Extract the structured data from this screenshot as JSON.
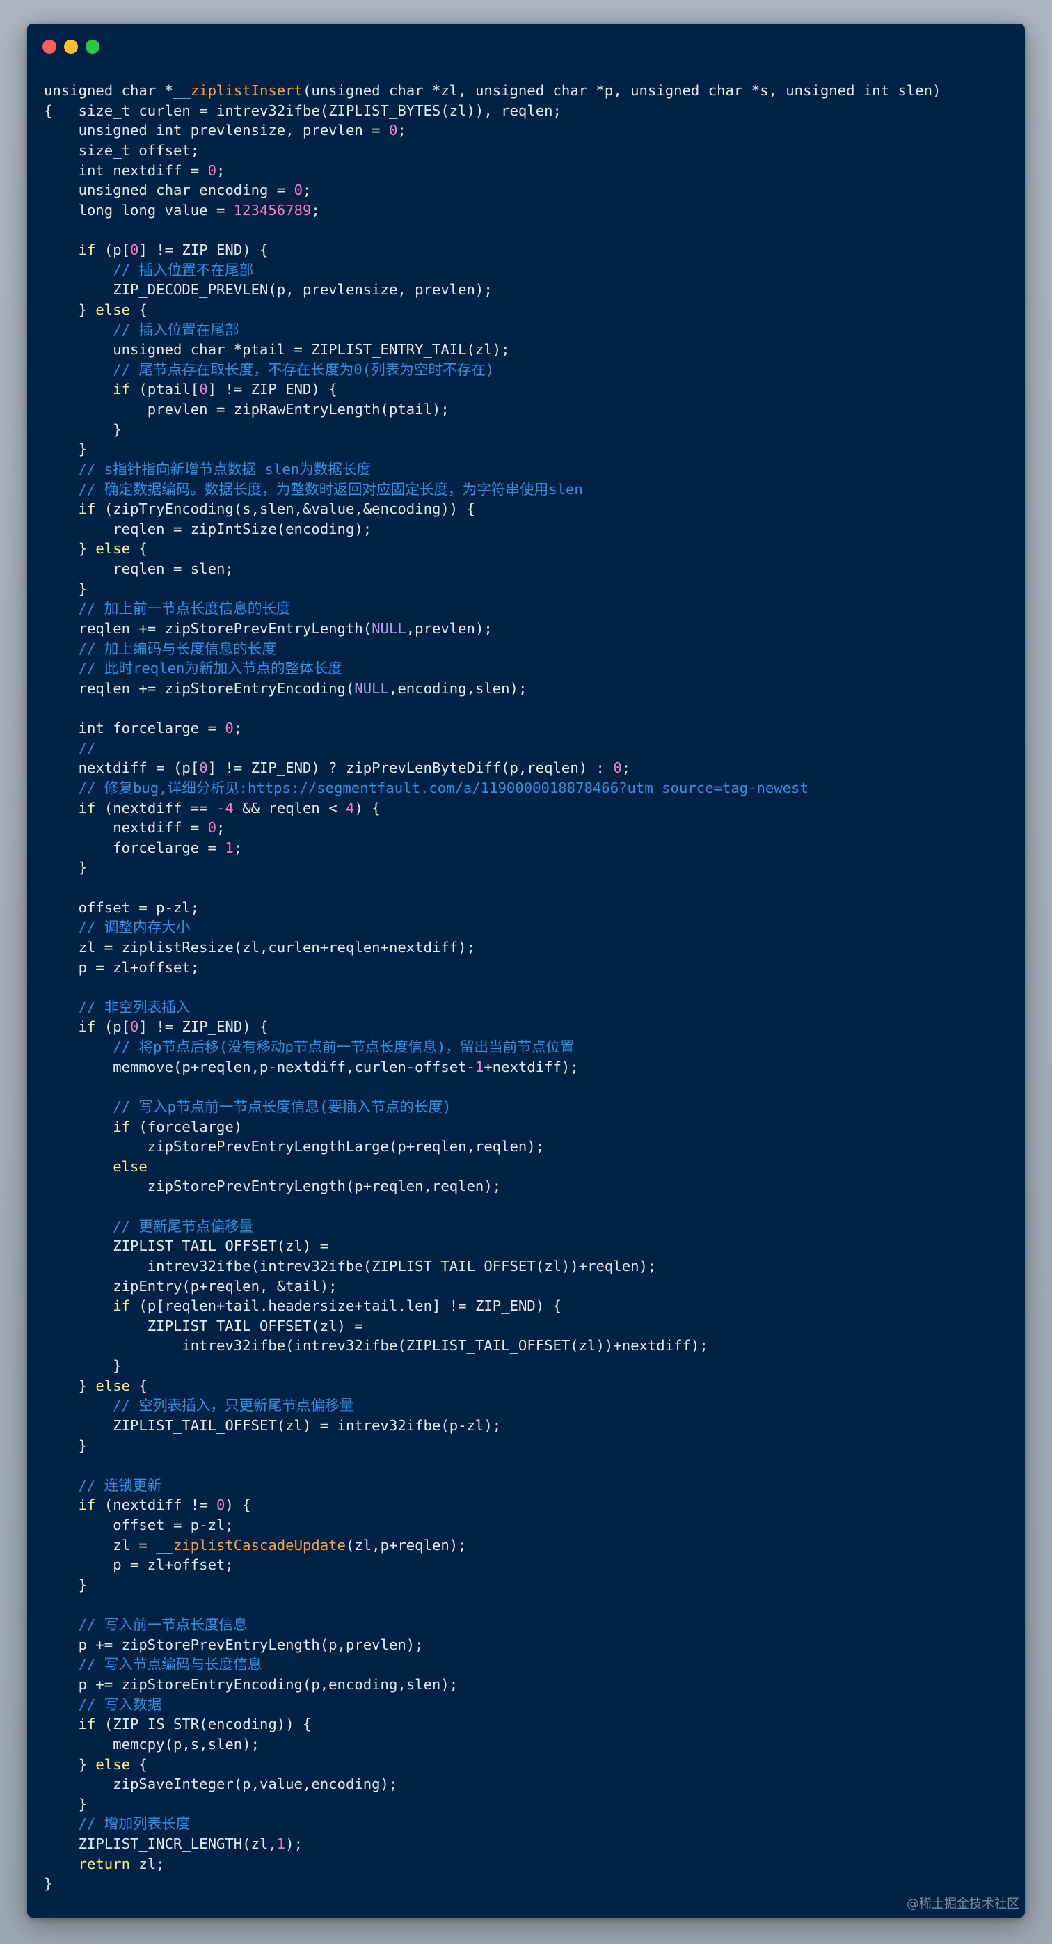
{
  "window": {
    "buttons": [
      "close",
      "minimize",
      "maximize"
    ],
    "colors": {
      "background": "#002244",
      "red": "#ff5f57",
      "yellow": "#febc2e",
      "green": "#28c840"
    }
  },
  "code_lines": [
    [
      [
        "",
        "unsigned char *"
      ],
      [
        "fn",
        "__ziplistInsert"
      ],
      [
        "",
        "(unsigned char *zl, unsigned char *p, unsigned char *s, unsigned int slen)"
      ]
    ],
    [
      [
        "",
        "{   size_t curlen = intrev32ifbe(ZIPLIST_BYTES(zl)), reqlen;"
      ]
    ],
    [
      [
        "",
        "    unsigned int prevlensize, prevlen = "
      ],
      [
        "num",
        "0"
      ],
      [
        "",
        ";"
      ]
    ],
    [
      [
        "",
        "    size_t offset;"
      ]
    ],
    [
      [
        "",
        "    int nextdiff = "
      ],
      [
        "num",
        "0"
      ],
      [
        "",
        ";"
      ]
    ],
    [
      [
        "",
        "    unsigned char encoding = "
      ],
      [
        "num",
        "0"
      ],
      [
        "",
        ";"
      ]
    ],
    [
      [
        "",
        "    long long value = "
      ],
      [
        "num",
        "123456789"
      ],
      [
        "",
        ";"
      ]
    ],
    [],
    [
      [
        "",
        "    "
      ],
      [
        "kw",
        "if"
      ],
      [
        "",
        " (p["
      ],
      [
        "num",
        "0"
      ],
      [
        "",
        "] != ZIP_END) {"
      ]
    ],
    [
      [
        "",
        "        "
      ],
      [
        "cm",
        "// 插入位置不在尾部"
      ]
    ],
    [
      [
        "",
        "        ZIP_DECODE_PREVLEN(p, prevlensize, prevlen);"
      ]
    ],
    [
      [
        "",
        "    } "
      ],
      [
        "kw",
        "else"
      ],
      [
        "",
        " {"
      ]
    ],
    [
      [
        "",
        "        "
      ],
      [
        "cm",
        "// 插入位置在尾部"
      ]
    ],
    [
      [
        "",
        "        unsigned char *ptail = ZIPLIST_ENTRY_TAIL(zl);"
      ]
    ],
    [
      [
        "",
        "        "
      ],
      [
        "cm",
        "// 尾节点存在取长度，不存在长度为0(列表为空时不存在)"
      ]
    ],
    [
      [
        "",
        "        "
      ],
      [
        "kw",
        "if"
      ],
      [
        "",
        " (ptail["
      ],
      [
        "num",
        "0"
      ],
      [
        "",
        "] != ZIP_END) {"
      ]
    ],
    [
      [
        "",
        "            prevlen = zipRawEntryLength(ptail);"
      ]
    ],
    [
      [
        "",
        "        }"
      ]
    ],
    [
      [
        "",
        "    }"
      ]
    ],
    [
      [
        "",
        "    "
      ],
      [
        "cm",
        "// s指针指向新增节点数据 slen为数据长度"
      ]
    ],
    [
      [
        "",
        "    "
      ],
      [
        "cm",
        "// 确定数据编码。数据长度，为整数时返回对应固定长度，为字符串使用slen"
      ]
    ],
    [
      [
        "",
        "    "
      ],
      [
        "kw",
        "if"
      ],
      [
        "",
        " (zipTryEncoding(s,slen,&value,&encoding)) {"
      ]
    ],
    [
      [
        "",
        "        reqlen = zipIntSize(encoding);"
      ]
    ],
    [
      [
        "",
        "    } "
      ],
      [
        "kw",
        "else"
      ],
      [
        "",
        " {"
      ]
    ],
    [
      [
        "",
        "        reqlen = slen;"
      ]
    ],
    [
      [
        "",
        "    }"
      ]
    ],
    [
      [
        "",
        "    "
      ],
      [
        "cm",
        "// 加上前一节点长度信息的长度"
      ]
    ],
    [
      [
        "",
        "    reqlen += zipStorePrevEntryLength("
      ],
      [
        "nl",
        "NULL"
      ],
      [
        "",
        ",prevlen);"
      ]
    ],
    [
      [
        "",
        "    "
      ],
      [
        "cm",
        "// 加上编码与长度信息的长度"
      ]
    ],
    [
      [
        "",
        "    "
      ],
      [
        "cm",
        "// 此时reqlen为新加入节点的整体长度"
      ]
    ],
    [
      [
        "",
        "    reqlen += zipStoreEntryEncoding("
      ],
      [
        "nl",
        "NULL"
      ],
      [
        "",
        ",encoding,slen);"
      ]
    ],
    [],
    [
      [
        "",
        "    int forcelarge = "
      ],
      [
        "num",
        "0"
      ],
      [
        "",
        ";"
      ]
    ],
    [
      [
        "",
        "    "
      ],
      [
        "cm",
        "//"
      ]
    ],
    [
      [
        "",
        "    nextdiff = (p["
      ],
      [
        "num",
        "0"
      ],
      [
        "",
        "] != ZIP_END) ? zipPrevLenByteDiff(p,reqlen) : "
      ],
      [
        "num",
        "0"
      ],
      [
        "",
        ";"
      ]
    ],
    [
      [
        "",
        "    "
      ],
      [
        "cm",
        "// 修复bug,详细分析见:https://segmentfault.com/a/1190000018878466?utm_source=tag-newest"
      ]
    ],
    [
      [
        "",
        "    "
      ],
      [
        "kw",
        "if"
      ],
      [
        "",
        " (nextdiff == "
      ],
      [
        "num",
        "-4"
      ],
      [
        "",
        " && reqlen < "
      ],
      [
        "num",
        "4"
      ],
      [
        "",
        ") {"
      ]
    ],
    [
      [
        "",
        "        nextdiff = "
      ],
      [
        "num",
        "0"
      ],
      [
        "",
        ";"
      ]
    ],
    [
      [
        "",
        "        forcelarge = "
      ],
      [
        "num",
        "1"
      ],
      [
        "",
        ";"
      ]
    ],
    [
      [
        "",
        "    }"
      ]
    ],
    [],
    [
      [
        "",
        "    offset = p-zl;"
      ]
    ],
    [
      [
        "",
        "    "
      ],
      [
        "cm",
        "// 调整内存大小"
      ]
    ],
    [
      [
        "",
        "    zl = ziplistResize(zl,curlen+reqlen+nextdiff);"
      ]
    ],
    [
      [
        "",
        "    p = zl+offset;"
      ]
    ],
    [],
    [
      [
        "",
        "    "
      ],
      [
        "cm",
        "// 非空列表插入"
      ]
    ],
    [
      [
        "",
        "    "
      ],
      [
        "kw",
        "if"
      ],
      [
        "",
        " (p["
      ],
      [
        "num",
        "0"
      ],
      [
        "",
        "] != ZIP_END) {"
      ]
    ],
    [
      [
        "",
        "        "
      ],
      [
        "cm",
        "// 将p节点后移(没有移动p节点前一节点长度信息)，留出当前节点位置"
      ]
    ],
    [
      [
        "",
        "        memmove(p+reqlen,p-nextdiff,curlen-offset-"
      ],
      [
        "num",
        "1"
      ],
      [
        "",
        "+nextdiff);"
      ]
    ],
    [],
    [
      [
        "",
        "        "
      ],
      [
        "cm",
        "// 写入p节点前一节点长度信息(要插入节点的长度)"
      ]
    ],
    [
      [
        "",
        "        "
      ],
      [
        "kw",
        "if"
      ],
      [
        "",
        " (forcelarge)"
      ]
    ],
    [
      [
        "",
        "            zipStorePrevEntryLengthLarge(p+reqlen,reqlen);"
      ]
    ],
    [
      [
        "",
        "        "
      ],
      [
        "kw",
        "else"
      ]
    ],
    [
      [
        "",
        "            zipStorePrevEntryLength(p+reqlen,reqlen);"
      ]
    ],
    [],
    [
      [
        "",
        "        "
      ],
      [
        "cm",
        "// 更新尾节点偏移量"
      ]
    ],
    [
      [
        "",
        "        ZIPLIST_TAIL_OFFSET(zl) ="
      ]
    ],
    [
      [
        "",
        "            intrev32ifbe(intrev32ifbe(ZIPLIST_TAIL_OFFSET(zl))+reqlen);"
      ]
    ],
    [
      [
        "",
        "        zipEntry(p+reqlen, &tail);"
      ]
    ],
    [
      [
        "",
        "        "
      ],
      [
        "kw",
        "if"
      ],
      [
        "",
        " (p[reqlen+tail.headersize+tail.len] != ZIP_END) {"
      ]
    ],
    [
      [
        "",
        "            ZIPLIST_TAIL_OFFSET(zl) ="
      ]
    ],
    [
      [
        "",
        "                intrev32ifbe(intrev32ifbe(ZIPLIST_TAIL_OFFSET(zl))+nextdiff);"
      ]
    ],
    [
      [
        "",
        "        }"
      ]
    ],
    [
      [
        "",
        "    } "
      ],
      [
        "kw",
        "else"
      ],
      [
        "",
        " {"
      ]
    ],
    [
      [
        "",
        "        "
      ],
      [
        "cm",
        "// 空列表插入，只更新尾节点偏移量"
      ]
    ],
    [
      [
        "",
        "        ZIPLIST_TAIL_OFFSET(zl) = intrev32ifbe(p-zl);"
      ]
    ],
    [
      [
        "",
        "    }"
      ]
    ],
    [],
    [
      [
        "",
        "    "
      ],
      [
        "cm",
        "// 连锁更新"
      ]
    ],
    [
      [
        "",
        "    "
      ],
      [
        "kw",
        "if"
      ],
      [
        "",
        " (nextdiff != "
      ],
      [
        "num",
        "0"
      ],
      [
        "",
        ") {"
      ]
    ],
    [
      [
        "",
        "        offset = p-zl;"
      ]
    ],
    [
      [
        "",
        "        zl = "
      ],
      [
        "fn",
        "__ziplistCascadeUpdate"
      ],
      [
        "",
        "(zl,p+reqlen);"
      ]
    ],
    [
      [
        "",
        "        p = zl+offset;"
      ]
    ],
    [
      [
        "",
        "    }"
      ]
    ],
    [],
    [
      [
        "",
        "    "
      ],
      [
        "cm",
        "// 写入前一节点长度信息"
      ]
    ],
    [
      [
        "",
        "    p += zipStorePrevEntryLength(p,prevlen);"
      ]
    ],
    [
      [
        "",
        "    "
      ],
      [
        "cm",
        "// 写入节点编码与长度信息"
      ]
    ],
    [
      [
        "",
        "    p += zipStoreEntryEncoding(p,encoding,slen);"
      ]
    ],
    [
      [
        "",
        "    "
      ],
      [
        "cm",
        "// 写入数据"
      ]
    ],
    [
      [
        "",
        "    "
      ],
      [
        "kw",
        "if"
      ],
      [
        "",
        " (ZIP_IS_STR(encoding)) {"
      ]
    ],
    [
      [
        "",
        "        memcpy(p,s,slen);"
      ]
    ],
    [
      [
        "",
        "    } "
      ],
      [
        "kw",
        "else"
      ],
      [
        "",
        " {"
      ]
    ],
    [
      [
        "",
        "        zipSaveInteger(p,value,encoding);"
      ]
    ],
    [
      [
        "",
        "    }"
      ]
    ],
    [
      [
        "",
        "    "
      ],
      [
        "cm",
        "// 增加列表长度"
      ]
    ],
    [
      [
        "",
        "    ZIPLIST_INCR_LENGTH(zl,"
      ],
      [
        "num",
        "1"
      ],
      [
        "",
        ");"
      ]
    ],
    [
      [
        "",
        "    "
      ],
      [
        "kw",
        "return"
      ],
      [
        "",
        " zl;"
      ]
    ],
    [
      [
        "",
        "}"
      ]
    ]
  ],
  "watermark": "@稀土掘金技术社区"
}
